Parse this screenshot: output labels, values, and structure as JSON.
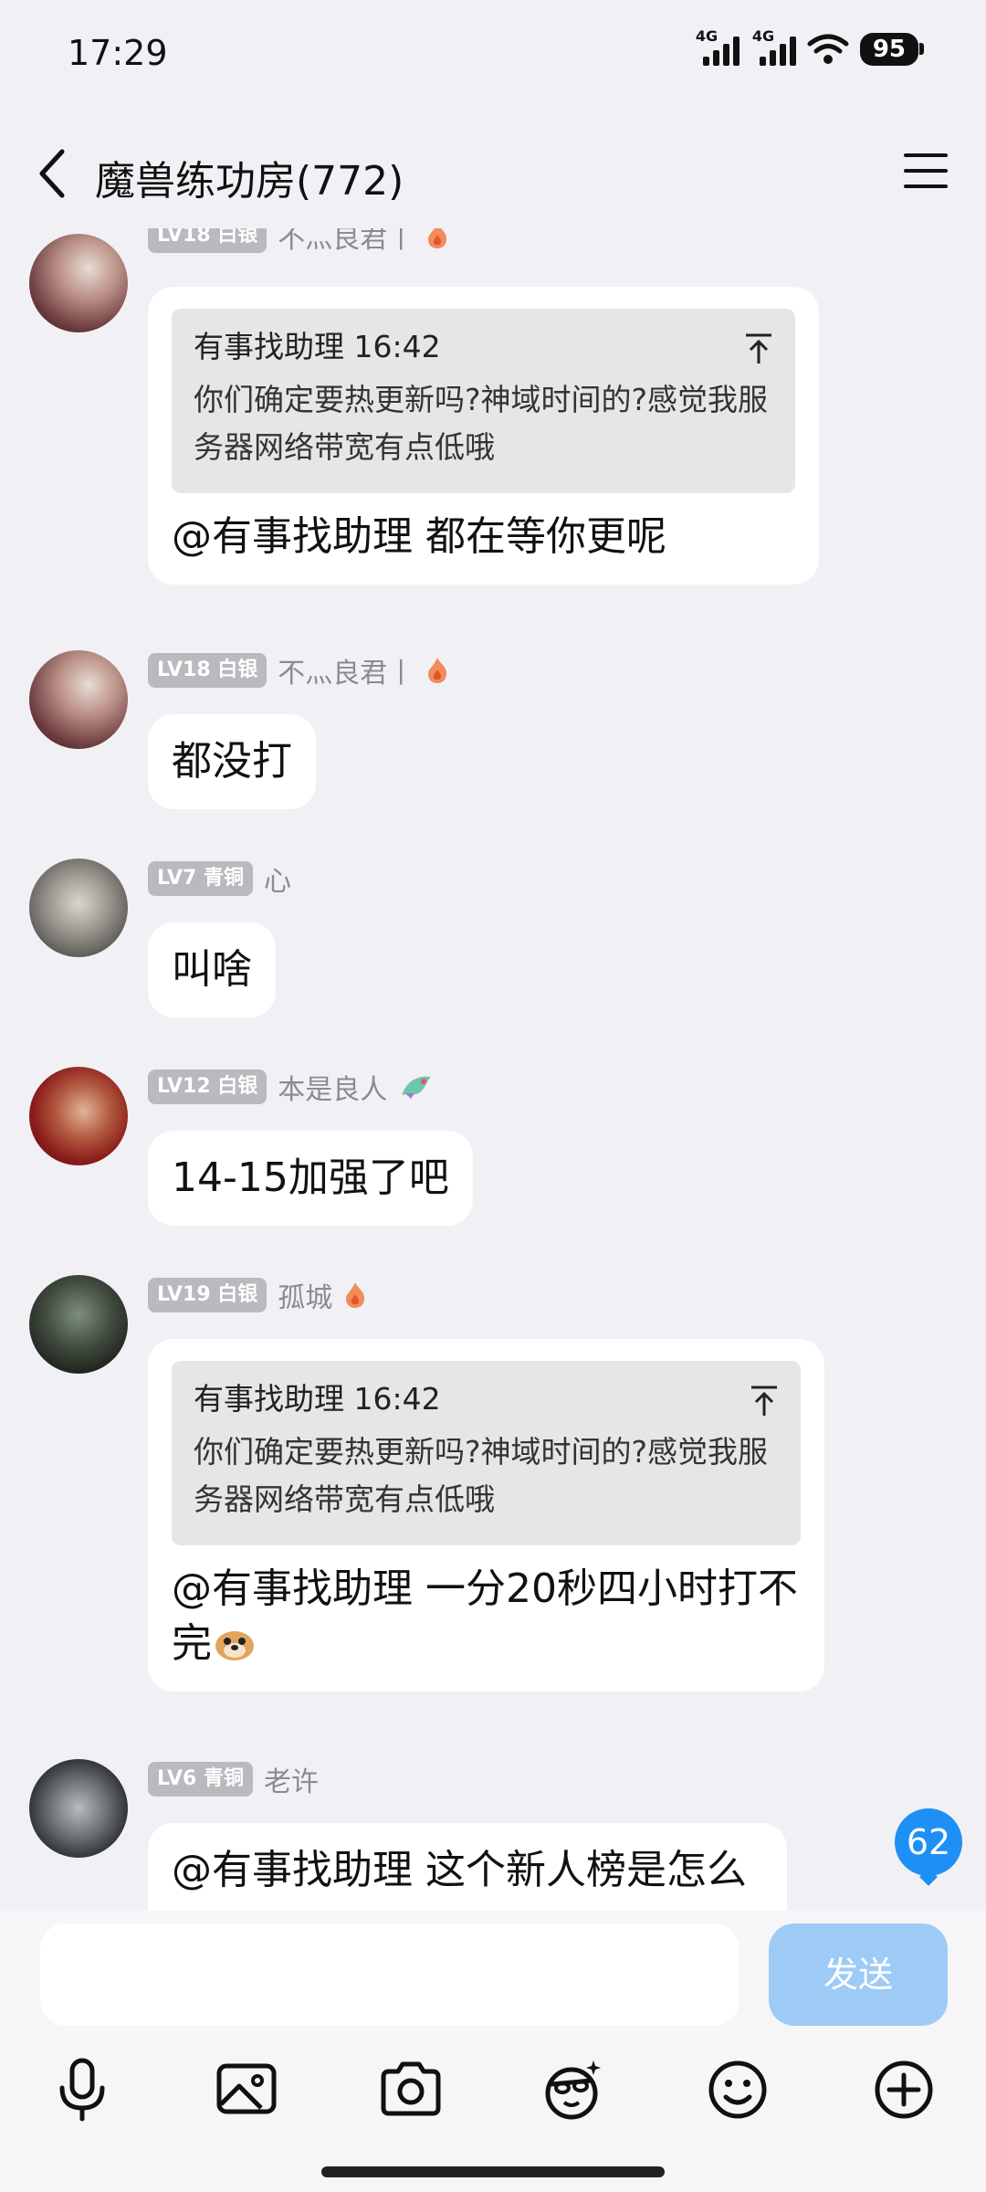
{
  "status_bar": {
    "time": "17:29",
    "signal1_label": "4G",
    "signal2_label": "4G",
    "battery": "95"
  },
  "header": {
    "title": "魔兽练功房(772)"
  },
  "messages": [
    {
      "level": "LV18 白银",
      "name": "不灬良君丨",
      "quote_header": "有事找助理 16:42",
      "quote_body": "你们确定要热更新吗?神域时间的?感觉我服务器网络带宽有点低哦",
      "text": "@有事找助理 都在等你更呢"
    },
    {
      "level": "LV18 白银",
      "name": "不灬良君丨",
      "text": "都没打"
    },
    {
      "level": "LV7 青铜",
      "name": "心",
      "text": "叫啥"
    },
    {
      "level": "LV12 白银",
      "name": "本是良人",
      "text": "14-15加强了吧"
    },
    {
      "level": "LV19 白银",
      "name": "孤城",
      "quote_header": "有事找助理 16:42",
      "quote_body": "你们确定要热更新吗?神域时间的?感觉我服务器网络带宽有点低哦",
      "text": "@有事找助理 一分20秒四小时打不完"
    },
    {
      "level": "LV6 青铜",
      "name": "老许",
      "text": "@有事找助理 这个新人榜是怎么"
    }
  ],
  "unread_count": "62",
  "composer": {
    "input_value": "",
    "send_label": "发送"
  },
  "icons": {
    "back": "chevron-left-icon",
    "menu": "hamburger-menu-icon",
    "jump_to_quote": "arrow-up-to-line-icon",
    "toolbar": [
      "microphone-icon",
      "image-icon",
      "camera-icon",
      "sticker-icon",
      "emoji-icon",
      "plus-icon"
    ]
  },
  "colors": {
    "background": "#F1F1F5",
    "bubble": "#FFFFFF",
    "quote_bg": "#E6E6E9",
    "level_badge": "#B9B9BE",
    "accent_blue": "#1E90F5",
    "send_disabled": "#9ECBF6"
  }
}
